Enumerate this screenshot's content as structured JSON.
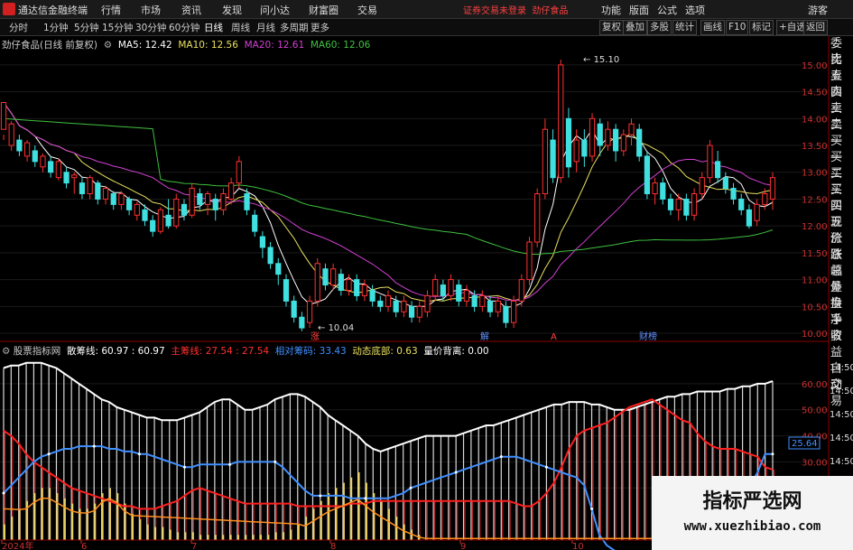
{
  "titlebar": {
    "app_name": "通达信金融终端",
    "menu": [
      "行情",
      "市场",
      "资讯",
      "发现",
      "问小达",
      "财富圈",
      "交易"
    ],
    "notice": "证券交易未登录",
    "stock": "劲仔食品",
    "right_menu": [
      "功能",
      "版面",
      "公式",
      "选项"
    ],
    "guest": "游客"
  },
  "periods": [
    "分时",
    "1分钟",
    "5分钟",
    "15分钟",
    "30分钟",
    "60分钟",
    "日线",
    "周线",
    "月线",
    "多周期",
    "更多"
  ],
  "active_period": "日线",
  "toolbar_right": [
    "复权",
    "叠加",
    "多股",
    "统计",
    "画线",
    "F10",
    "标记",
    "+自选",
    "返回"
  ],
  "main_legend": {
    "title": "劲仔食品(日线 前复权)",
    "ma": [
      {
        "label": "MA5: 12.42",
        "color": "#ffffff"
      },
      {
        "label": "MA10: 12.56",
        "color": "#e8e060"
      },
      {
        "label": "MA20: 12.61",
        "color": "#d040d0"
      },
      {
        "label": "MA60: 12.06",
        "color": "#40c040"
      }
    ]
  },
  "sidebar": [
    "委比",
    "卖五",
    "卖四",
    "卖三",
    "卖二",
    "卖一",
    "买一",
    "买二",
    "买三",
    "买四",
    "买五",
    "现价",
    "涨跌",
    "涨幅",
    "总量",
    "外盘",
    "换手",
    "净资",
    "收益",
    "",
    "自动",
    "交易"
  ],
  "price_axis": [
    "15.00",
    "14.50",
    "14.00",
    "13.50",
    "13.00",
    "12.50",
    "12.00",
    "11.50",
    "11.00",
    "10.50",
    "10.00"
  ],
  "annotations": {
    "high": "15.10",
    "low": "10.04"
  },
  "event_marks": [
    "涨",
    "解",
    "A",
    "财榜"
  ],
  "sub_legend": {
    "title": "股票指标网",
    "items": [
      {
        "label": "散筹线: 60.97 : 60.97",
        "color": "#ffffff"
      },
      {
        "label": "主筹线: 27.54 : 27.54",
        "color": "#ff3030"
      },
      {
        "label": "相对筹码: 33.43",
        "color": "#4090ff"
      },
      {
        "label": "动态底部: 0.63",
        "color": "#e8e060"
      },
      {
        "label": "量价背离: 0.00",
        "color": "#ffffff"
      }
    ]
  },
  "sub_axis": [
    "60.00",
    "50.00",
    "40.00",
    "30.00",
    "20.00"
  ],
  "sub_time_labels": [
    "14:50",
    "14:50",
    "14:50",
    "14:50",
    "14:50",
    "14:50"
  ],
  "sub_value_badge": "25.64",
  "x_axis": [
    {
      "label": "2024年"
    },
    {
      "label": "6"
    },
    {
      "label": "7"
    },
    {
      "label": "8"
    },
    {
      "label": "9"
    },
    {
      "label": "10"
    }
  ],
  "watermark": {
    "line1": "指标严选网",
    "line2": "www.xuezhibiao.com"
  },
  "chart_data": [
    {
      "type": "candlestick",
      "title": "劲仔食品(日线 前复权)",
      "ylim": [
        10.0,
        15.2
      ],
      "note_values": {
        "high": 15.1,
        "low": 10.04
      },
      "candles": [
        [
          13.8,
          14.3,
          13.7,
          13.6
        ],
        [
          13.5,
          13.9,
          13.95,
          13.4
        ],
        [
          13.6,
          13.4,
          13.7,
          13.3
        ],
        [
          13.3,
          13.55,
          13.6,
          13.2
        ],
        [
          13.4,
          13.2,
          13.5,
          13.1
        ],
        [
          13.1,
          13.3,
          13.35,
          13.0
        ],
        [
          13.2,
          13.0,
          13.3,
          12.9
        ],
        [
          12.9,
          13.2,
          13.25,
          12.85
        ],
        [
          13.0,
          12.8,
          13.1,
          12.7
        ],
        [
          12.9,
          12.95,
          13.0,
          12.6
        ],
        [
          12.8,
          12.6,
          12.9,
          12.5
        ],
        [
          12.6,
          12.9,
          12.95,
          12.5
        ],
        [
          12.8,
          12.5,
          12.85,
          12.4
        ],
        [
          12.5,
          12.7,
          12.75,
          12.4
        ],
        [
          12.6,
          12.4,
          12.65,
          12.3
        ],
        [
          12.4,
          12.6,
          12.65,
          12.3
        ],
        [
          12.5,
          12.3,
          12.55,
          12.2
        ],
        [
          12.2,
          12.4,
          12.45,
          12.1
        ],
        [
          12.3,
          12.1,
          12.4,
          12.0
        ],
        [
          12.1,
          11.9,
          12.2,
          11.8
        ],
        [
          11.9,
          12.3,
          12.35,
          11.85
        ],
        [
          12.2,
          12.0,
          12.5,
          11.95
        ],
        [
          12.0,
          12.5,
          12.6,
          11.95
        ],
        [
          12.4,
          12.2,
          12.5,
          12.1
        ],
        [
          12.2,
          12.7,
          12.8,
          12.15
        ],
        [
          12.6,
          12.4,
          12.7,
          12.3
        ],
        [
          12.4,
          12.6,
          12.65,
          12.2
        ],
        [
          12.5,
          12.3,
          12.6,
          12.1
        ],
        [
          12.3,
          12.6,
          12.7,
          12.2
        ],
        [
          12.5,
          12.8,
          12.9,
          12.4
        ],
        [
          12.8,
          13.2,
          13.3,
          12.7
        ],
        [
          12.6,
          12.3,
          12.7,
          12.2
        ],
        [
          12.2,
          11.9,
          12.3,
          11.8
        ],
        [
          11.8,
          11.6,
          11.9,
          11.4
        ],
        [
          11.6,
          11.3,
          11.7,
          11.2
        ],
        [
          11.3,
          11.1,
          11.4,
          10.9
        ],
        [
          11.0,
          10.6,
          11.1,
          10.5
        ],
        [
          10.6,
          10.3,
          10.7,
          10.2
        ],
        [
          10.3,
          10.1,
          10.4,
          10.04
        ],
        [
          10.2,
          10.6,
          10.7,
          10.1
        ],
        [
          10.6,
          11.3,
          11.4,
          10.5
        ],
        [
          11.2,
          10.9,
          11.3,
          10.8
        ],
        [
          10.9,
          11.2,
          11.3,
          10.8
        ],
        [
          11.1,
          10.8,
          11.2,
          10.7
        ],
        [
          10.8,
          11.0,
          11.1,
          10.7
        ],
        [
          11.0,
          10.7,
          11.1,
          10.6
        ],
        [
          10.7,
          10.9,
          11.0,
          10.6
        ],
        [
          10.8,
          10.6,
          10.9,
          10.5
        ],
        [
          10.6,
          10.5,
          10.7,
          10.4
        ],
        [
          10.5,
          10.7,
          10.8,
          10.4
        ],
        [
          10.6,
          10.4,
          10.7,
          10.3
        ],
        [
          10.4,
          10.6,
          10.7,
          10.3
        ],
        [
          10.5,
          10.3,
          10.6,
          10.2
        ],
        [
          10.3,
          10.5,
          10.6,
          10.2
        ],
        [
          10.4,
          10.7,
          10.8,
          10.3
        ],
        [
          10.7,
          11.0,
          11.1,
          10.6
        ],
        [
          10.9,
          10.7,
          11.0,
          10.6
        ],
        [
          10.7,
          11.0,
          11.1,
          10.6
        ],
        [
          10.9,
          10.6,
          11.0,
          10.5
        ],
        [
          10.6,
          10.8,
          10.9,
          10.5
        ],
        [
          10.7,
          10.5,
          10.8,
          10.4
        ],
        [
          10.5,
          10.7,
          10.8,
          10.4
        ],
        [
          10.6,
          10.4,
          10.7,
          10.3
        ],
        [
          10.4,
          10.6,
          10.7,
          10.3
        ],
        [
          10.5,
          10.2,
          10.6,
          10.1
        ],
        [
          10.2,
          10.6,
          10.7,
          10.1
        ],
        [
          10.6,
          11.0,
          11.1,
          10.5
        ],
        [
          11.0,
          11.7,
          11.8,
          10.9
        ],
        [
          11.7,
          12.6,
          12.7,
          11.6
        ],
        [
          12.6,
          13.8,
          14.0,
          12.5
        ],
        [
          13.6,
          12.9,
          13.8,
          12.8
        ],
        [
          12.9,
          15.0,
          15.1,
          12.8
        ],
        [
          14.0,
          13.1,
          14.2,
          12.9
        ],
        [
          13.2,
          13.6,
          13.8,
          13.0
        ],
        [
          13.6,
          13.3,
          13.8,
          13.1
        ],
        [
          13.3,
          14.0,
          14.1,
          13.2
        ],
        [
          13.9,
          13.5,
          14.0,
          13.3
        ],
        [
          13.5,
          13.8,
          13.95,
          13.4
        ],
        [
          13.8,
          13.4,
          13.9,
          13.2
        ],
        [
          13.4,
          13.7,
          13.8,
          13.3
        ],
        [
          13.7,
          13.9,
          14.0,
          13.5
        ],
        [
          13.8,
          13.3,
          13.9,
          13.2
        ],
        [
          13.3,
          12.6,
          13.4,
          12.5
        ],
        [
          12.6,
          12.8,
          12.9,
          12.4
        ],
        [
          12.8,
          12.5,
          12.9,
          12.4
        ],
        [
          12.5,
          12.3,
          12.6,
          12.2
        ],
        [
          12.3,
          12.5,
          12.6,
          12.1
        ],
        [
          12.5,
          12.2,
          12.6,
          12.1
        ],
        [
          12.2,
          12.6,
          12.7,
          12.1
        ],
        [
          12.6,
          12.9,
          13.0,
          12.5
        ],
        [
          12.9,
          13.5,
          13.6,
          12.8
        ],
        [
          13.2,
          12.9,
          13.4,
          12.8
        ],
        [
          12.9,
          12.7,
          13.0,
          12.6
        ],
        [
          12.7,
          12.5,
          12.8,
          12.4
        ],
        [
          12.5,
          12.3,
          12.6,
          12.2
        ],
        [
          12.3,
          12.0,
          12.4,
          11.95
        ],
        [
          12.1,
          12.4,
          12.5,
          12.0
        ],
        [
          12.4,
          12.6,
          12.7,
          12.3
        ],
        [
          12.5,
          12.9,
          13.0,
          12.3
        ]
      ]
    },
    {
      "type": "line",
      "title": "股票指标网",
      "ylim": [
        0,
        70
      ],
      "series": [
        {
          "name": "散筹线",
          "values": [
            66,
            67,
            67,
            68,
            68,
            68,
            67,
            66,
            64,
            62,
            60,
            58,
            56,
            54,
            53,
            51,
            50,
            49,
            48,
            47,
            47,
            46,
            46,
            46,
            47,
            48,
            49,
            51,
            53,
            54,
            54,
            52,
            50,
            50,
            51,
            52,
            54,
            55,
            56,
            56,
            55,
            53,
            51,
            48,
            46,
            44,
            42,
            40,
            37,
            35,
            34,
            35,
            36,
            37,
            38,
            39,
            40,
            40,
            40,
            40,
            40,
            41,
            42,
            43,
            44,
            44,
            45,
            46,
            47,
            48,
            49,
            50,
            51,
            52,
            52,
            53,
            53,
            53,
            52,
            52,
            51,
            50,
            50,
            50,
            51,
            52,
            53,
            54,
            55,
            55,
            56,
            56,
            57,
            57,
            57,
            57,
            58,
            58,
            59,
            59,
            60,
            60,
            61
          ]
        },
        {
          "name": "主筹线",
          "values": [
            42,
            40,
            37,
            33,
            30,
            28,
            26,
            24,
            22,
            20,
            19,
            18,
            17,
            16,
            15,
            14,
            13,
            13,
            12,
            12,
            12,
            13,
            14,
            15,
            17,
            19,
            20,
            19,
            18,
            17,
            16,
            15,
            14,
            14,
            14,
            14,
            14,
            14,
            14,
            13,
            13,
            13,
            13,
            13,
            13,
            13,
            14,
            14,
            14,
            15,
            15,
            15,
            15,
            15,
            15,
            15,
            15,
            15,
            15,
            15,
            15,
            15,
            15,
            15,
            15,
            15,
            15,
            15,
            14,
            13,
            13,
            15,
            18,
            22,
            28,
            35,
            40,
            42,
            43,
            44,
            45,
            47,
            49,
            51,
            52,
            53,
            54,
            52,
            50,
            48,
            46,
            45,
            41,
            38,
            36,
            35,
            35,
            35,
            34,
            33,
            32,
            28,
            27
          ]
        },
        {
          "name": "相对筹码",
          "values": [
            18,
            21,
            24,
            27,
            30,
            32,
            33,
            34,
            35,
            35,
            36,
            36,
            36,
            36,
            35,
            35,
            34,
            34,
            33,
            33,
            32,
            31,
            30,
            29,
            28,
            28,
            29,
            29,
            29,
            29,
            29,
            30,
            30,
            30,
            30,
            30,
            30,
            28,
            25,
            22,
            19,
            17,
            17,
            17,
            17,
            17,
            16,
            16,
            16,
            16,
            16,
            16,
            17,
            18,
            20,
            21,
            22,
            23,
            24,
            25,
            26,
            27,
            28,
            29,
            30,
            31,
            32,
            32,
            32,
            31,
            30,
            29,
            28,
            27,
            26,
            25,
            24,
            21,
            12,
            2,
            -2,
            -4,
            -6,
            -7,
            -8,
            -8,
            -8,
            -7,
            -6,
            -5,
            -3,
            -1,
            2,
            6,
            10,
            14,
            17,
            18,
            19,
            21,
            26,
            33,
            33
          ]
        },
        {
          "name": "动态底部",
          "values": [
            6,
            9,
            12,
            15,
            18,
            20,
            20,
            18,
            16,
            14,
            12,
            12,
            14,
            18,
            20,
            18,
            14,
            10,
            8,
            6,
            5,
            5,
            4,
            3,
            3,
            3,
            2,
            2,
            2,
            2,
            2,
            2,
            2,
            2,
            2,
            2,
            3,
            3,
            4,
            6,
            9,
            12,
            15,
            18,
            20,
            22,
            24,
            26,
            22,
            18,
            15,
            12,
            9,
            6,
            4,
            2,
            1,
            1,
            1,
            1,
            1,
            1,
            1,
            1,
            1,
            1,
            1,
            1,
            1,
            1,
            1,
            1,
            1,
            1,
            1,
            1,
            1,
            1,
            1,
            1,
            1,
            1,
            1,
            1,
            1,
            1,
            1,
            1,
            1,
            1,
            1,
            1,
            1,
            1,
            1,
            1,
            1,
            1,
            1,
            1,
            1,
            1,
            1
          ]
        }
      ]
    }
  ]
}
